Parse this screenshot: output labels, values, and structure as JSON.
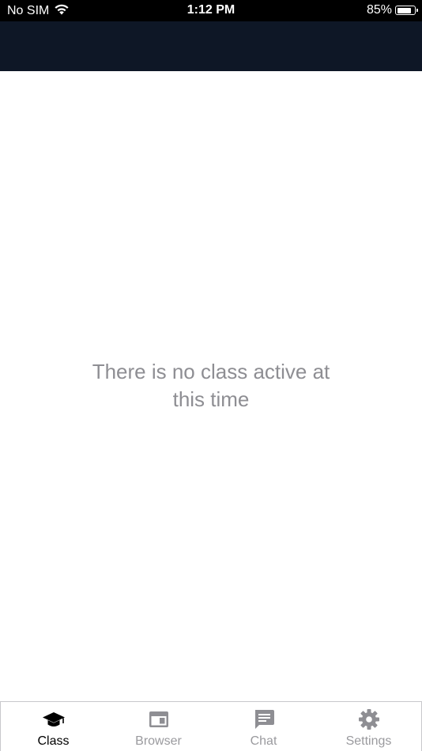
{
  "status_bar": {
    "carrier": "No SIM",
    "time": "1:12 PM",
    "battery_percent": "85%",
    "battery_level": 0.85,
    "wifi_icon": "wifi-icon",
    "battery_icon": "battery-icon"
  },
  "header": {
    "background_color": "#0e1726"
  },
  "main": {
    "empty_message": "There is no class active at this time"
  },
  "tab_bar": {
    "active_color": "#000000",
    "inactive_color": "#9a9a9e",
    "tabs": [
      {
        "label": "Class",
        "icon": "graduation-cap-icon",
        "active": true
      },
      {
        "label": "Browser",
        "icon": "browser-window-icon",
        "active": false
      },
      {
        "label": "Chat",
        "icon": "chat-bubble-icon",
        "active": false
      },
      {
        "label": "Settings",
        "icon": "gear-icon",
        "active": false
      }
    ]
  }
}
